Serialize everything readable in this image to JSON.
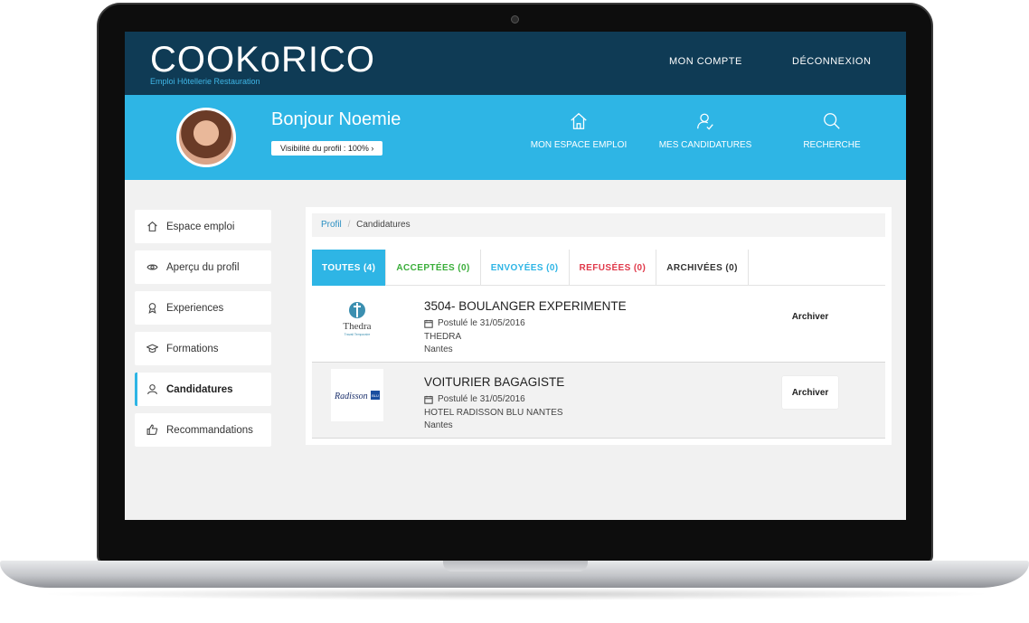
{
  "header": {
    "logo_text": "COOKoRICO",
    "logo_subtitle": "Emploi Hôtellerie Restauration",
    "nav": {
      "account": "MON COMPTE",
      "logout": "DÉCONNEXION"
    }
  },
  "hero": {
    "greeting": "Bonjour Noemie",
    "visibility": "Visibilité du profil : 100% ›",
    "nav": [
      {
        "label": "MON ESPACE EMPLOI",
        "icon": "home-icon"
      },
      {
        "label": "MES CANDIDATURES",
        "icon": "user-check-icon"
      },
      {
        "label": "RECHERCHE",
        "icon": "search-icon"
      }
    ]
  },
  "sidebar": {
    "items": [
      {
        "label": "Espace emploi",
        "icon": "home-icon"
      },
      {
        "label": "Aperçu du profil",
        "icon": "eye-icon"
      },
      {
        "label": "Experiences",
        "icon": "ribbon-icon"
      },
      {
        "label": "Formations",
        "icon": "graduation-cap-icon"
      },
      {
        "label": "Candidatures",
        "icon": "user-icon",
        "active": true
      },
      {
        "label": "Recommandations",
        "icon": "thumbs-up-icon"
      }
    ]
  },
  "breadcrumb": {
    "root": "Profil",
    "separator": "/",
    "current": "Candidatures"
  },
  "tabs": [
    {
      "label": "TOUTES (4)",
      "color": "#ffffff",
      "active": true
    },
    {
      "label": "ACCEPTÉES (0)",
      "color": "#3aae3a"
    },
    {
      "label": "ENVOYÉES (0)",
      "color": "#2eb5e5"
    },
    {
      "label": "REFUSÉES (0)",
      "color": "#e0394a"
    },
    {
      "label": "ARCHIVÉES (0)",
      "color": "#333333"
    }
  ],
  "applications": [
    {
      "title": "3504- BOULANGER EXPERIMENTE",
      "date": "Postulé le 31/05/2016",
      "company": "THEDRA",
      "city": "Nantes",
      "logo": "Thedra",
      "logo_tagline": "Travail Temporaire",
      "action": "Archiver"
    },
    {
      "title": "VOITURIER BAGAGISTE",
      "date": "Postulé le 31/05/2016",
      "company": "HOTEL RADISSON BLU NANTES",
      "city": "Nantes",
      "logo": "Radisson",
      "logo_badge": "BLU",
      "action": "Archiver"
    }
  ],
  "colors": {
    "navy": "#0f3b55",
    "accent": "#2eb5e5"
  }
}
